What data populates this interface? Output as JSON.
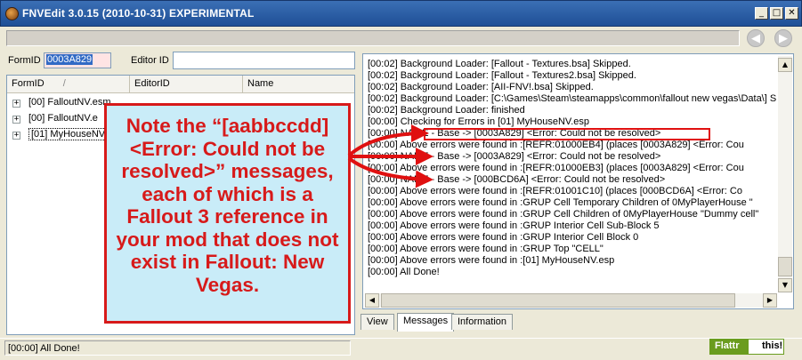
{
  "window": {
    "title": "FNVEdit 3.0.15 (2010-10-31) EXPERIMENTAL",
    "minimize": "_",
    "maximize": "□",
    "close": "✕"
  },
  "toolbar": {
    "back_icon": "◀",
    "forward_icon": "▶"
  },
  "filters": {
    "formid_label": "FormID",
    "formid_value": "0003A829",
    "editorid_label": "Editor ID",
    "editorid_value": ""
  },
  "tree": {
    "columns": [
      "FormID",
      "EditorID",
      "Name"
    ],
    "sort_indicator": "/",
    "rows": [
      {
        "label": "[00] FalloutNV.esm"
      },
      {
        "label": "[00] FalloutNV.e"
      },
      {
        "label": "[01] MyHouseNV"
      }
    ]
  },
  "annotation": {
    "note": "Note the “[aabbccdd] <Error: Could not be resolved>” messages, each of which is a Fallout 3 reference in your mod that does not exist in Fallout: New Vegas."
  },
  "messages": [
    "[00:02] Background Loader: [Fallout - Textures.bsa] Skipped.",
    "[00:02] Background Loader: [Fallout - Textures2.bsa] Skipped.",
    "[00:02] Background Loader: [AII-FNV!.bsa] Skipped.",
    "[00:02] Background Loader: [C:\\Games\\Steam\\steamapps\\common\\fallout new vegas\\Data\\] S",
    "[00:02] Background Loader: finished",
    "[00:00] Checking for Errors in [01] MyHouseNV.esp",
    "[00:00]              NAME - Base -> [0003A829] <Error: Could not be resolved>",
    "[00:00]              Above errors were found in :[REFR:01000EB4] (places [0003A829] <Error: Cou",
    "[00:00]              NAME - Base -> [0003A829] <Error: Could not be resolved>",
    "[00:00]              Above errors were found in :[REFR:01000EB3] (places [0003A829] <Error: Cou",
    "[00:00]              NAME - Base -> [000BCD6A] <Error: Could not be resolved>",
    "[00:00]              Above errors were found in :[REFR:01001C10] (places [000BCD6A] <Error: Co",
    "[00:00]          Above errors were found in :GRUP Cell Temporary Children of 0MyPlayerHouse \"",
    "[00:00]        Above errors were found in :GRUP Cell Children of 0MyPlayerHouse \"Dummy cell\"",
    "[00:00]      Above errors were found in :GRUP Interior Cell Sub-Block 5",
    "[00:00]    Above errors were found in :GRUP Interior Cell Block 0",
    "[00:00]  Above errors were found in :GRUP Top \"CELL\"",
    "[00:00] Above errors were found in :[01] MyHouseNV.esp",
    "[00:00] All Done!"
  ],
  "tabs": [
    {
      "label": "View",
      "active": false
    },
    {
      "label": "Messages",
      "active": true
    },
    {
      "label": "Information",
      "active": false
    }
  ],
  "status": {
    "text": "[00:00] All Done!",
    "flattr_label": "Flattr",
    "flattr_this": "this!"
  },
  "colors": {
    "annotation_red": "#d71a1a",
    "annotation_bg": "#c9ecf8",
    "title_blue": "#1f4f96"
  }
}
